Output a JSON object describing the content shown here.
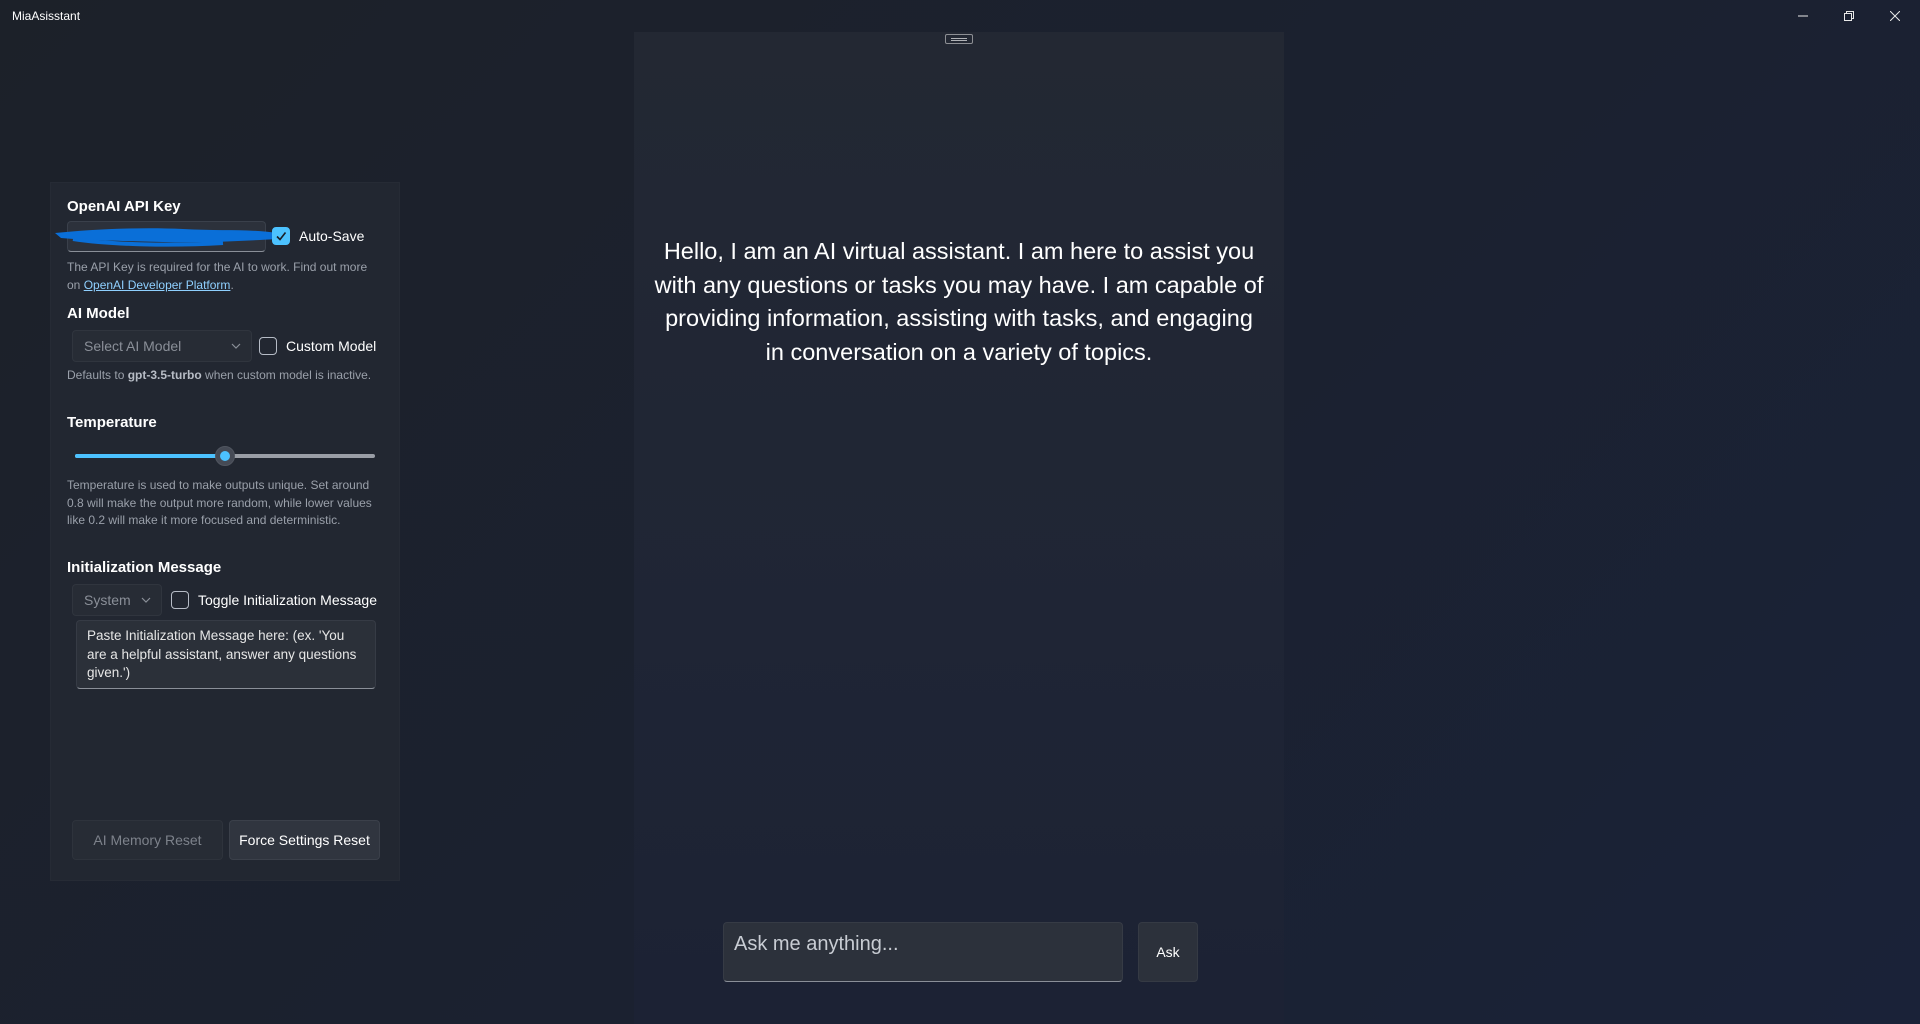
{
  "window": {
    "title": "MiaAsisstant",
    "controls": [
      "minimize-icon",
      "restore-icon",
      "close-icon"
    ]
  },
  "settings": {
    "api_key": {
      "heading": "OpenAI API Key",
      "value": "",
      "auto_save_label": "Auto-Save",
      "auto_save_checked": true,
      "help_text": "The API Key is required for the AI to work. Find out more on ",
      "help_link": "OpenAI Developer Platform",
      "help_suffix": "."
    },
    "ai_model": {
      "heading": "AI Model",
      "placeholder": "Select AI Model",
      "custom_model_label": "Custom Model",
      "custom_model_checked": false,
      "help_prefix": "Defaults to ",
      "help_model": "gpt-3.5-turbo",
      "help_suffix": " when custom model is inactive."
    },
    "temperature": {
      "heading": "Temperature",
      "value_fraction": 0.5,
      "help_text": "Temperature is used to make outputs unique. Set around 0.8 will make the output more random, while lower values like 0.2 will make it more focused and deterministic."
    },
    "init_message": {
      "heading": "Initialization Message",
      "role_selected": "System",
      "toggle_label": "Toggle Initialization Message",
      "toggle_checked": false,
      "placeholder": "Paste Initialization Message here: (ex. 'You are a helpful assistant, answer any questions given.')"
    },
    "buttons": {
      "memory_reset": "AI Memory Reset",
      "settings_reset": "Force Settings Reset"
    }
  },
  "chat": {
    "greeting": "Hello, I am an AI virtual assistant. I am here to assist you with any questions or tasks you may have. I am capable of providing information, assisting with tasks, and engaging in conversation on a variety of topics.",
    "input_placeholder": "Ask me anything...",
    "ask_label": "Ask"
  },
  "colors": {
    "accent": "#4cc2ff",
    "redaction": "#0a6fd8"
  }
}
